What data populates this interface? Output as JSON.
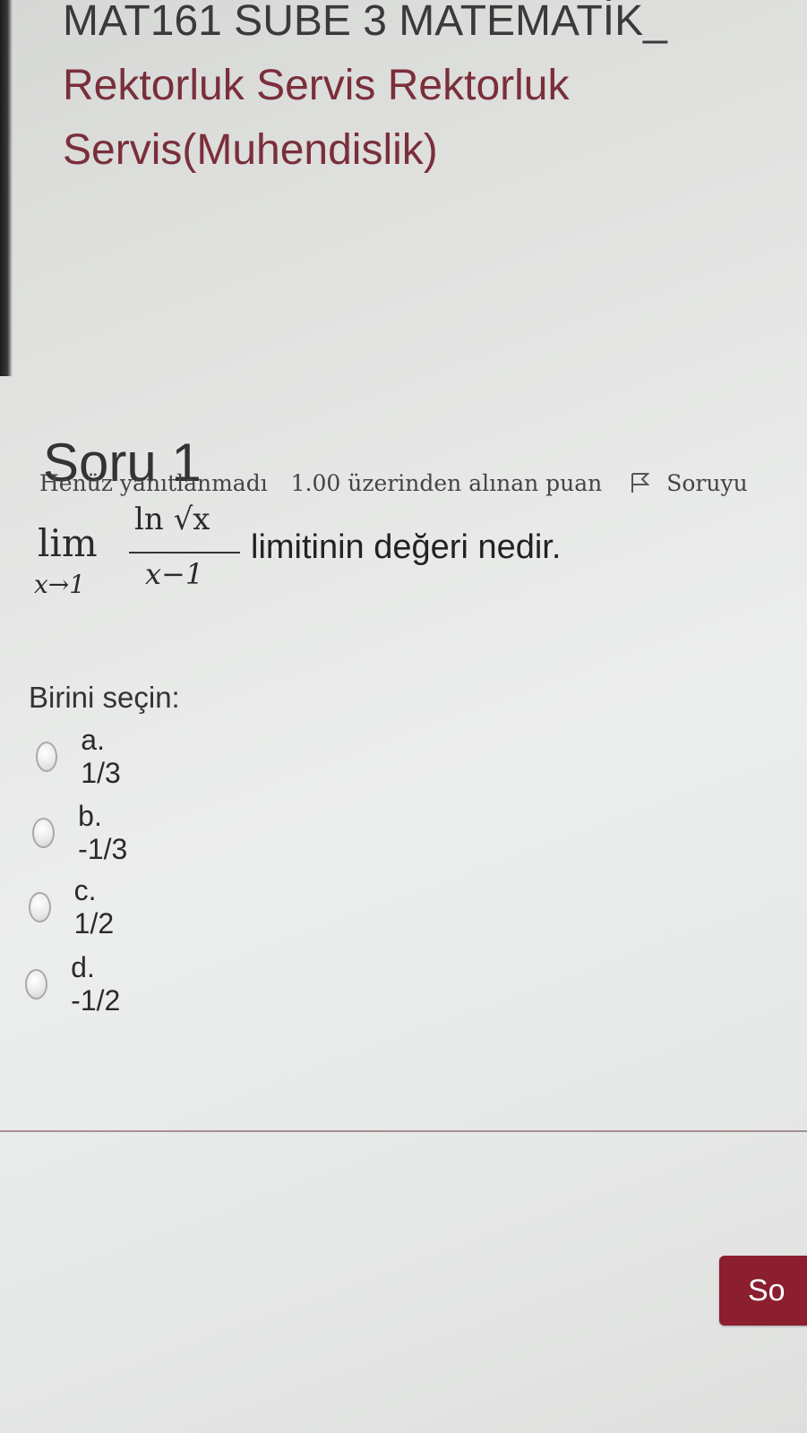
{
  "course": {
    "line1": "MAT161 SUBE 3 MATEMATİK_",
    "line2": "Rektorluk Servis Rektorluk",
    "line3": "Servis(Muhendislik)"
  },
  "question": {
    "title": "Soru 1",
    "status": "Henüz yanıtlanmadı",
    "mark_info": "1.00 üzerinden alınan puan",
    "flag_label": "Soruyu",
    "math": {
      "lim": "lim",
      "lim_sub": "x→1",
      "numerator": "ln √x",
      "denominator": "x−1"
    },
    "text": "limitinin değeri nedir.",
    "prompt": "Birini seçin:",
    "options": [
      {
        "label": "a. 1/3"
      },
      {
        "label": "b. -1/3"
      },
      {
        "label": "c. 1/2"
      },
      {
        "label": "d. -1/2"
      }
    ]
  },
  "navigation": {
    "next_label": "So"
  },
  "colors": {
    "accent": "#8b1e2f",
    "course_text": "#7a2f3a"
  },
  "icons": {
    "flag": "flag-icon"
  }
}
